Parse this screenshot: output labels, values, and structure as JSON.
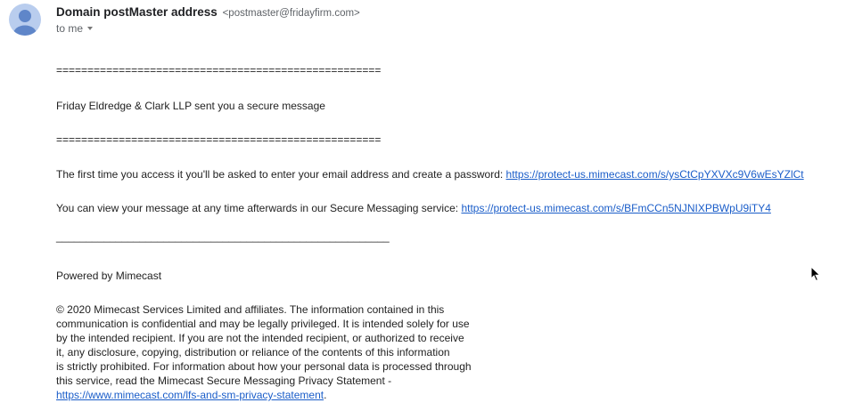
{
  "header": {
    "sender_name": "Domain postMaster address",
    "sender_email": "<postmaster@fridayfirm.com>",
    "recipient": "to me"
  },
  "body": {
    "separator": "====================================================",
    "title": "Friday  Eldredge & Clark  LLP sent you a secure message",
    "separator2": "====================================================",
    "first_access_text": "The first time you access it you'll be asked to enter your email address and create a password: ",
    "first_access_link": "https://protect-us.mimecast.com/s/ysCtCpYXVXc9V6wEsYZlCt",
    "view_text": "You can view your message at any time afterwards in our Secure Messaging service: ",
    "view_link": "https://protect-us.mimecast.com/s/BFmCCn5NJNIXPBWpU9iTY4",
    "underline": "________________________________________________________",
    "powered_by": "Powered by Mimecast",
    "legal_lines": [
      "© 2020 Mimecast Services Limited and affiliates. The information contained in this",
      "communication is confidential and may be legally privileged. It is intended solely for use",
      "by the intended recipient. If you are not the intended recipient, or authorized to receive",
      "it, any disclosure, copying, distribution or reliance of the contents of this information",
      "is strictly prohibited.  For information about how your personal data is processed through",
      "this service, read the Mimecast Secure Messaging Privacy Statement -"
    ],
    "privacy_link": "https://www.mimecast.com/lfs-and-sm-privacy-statement",
    "privacy_link_suffix": "."
  },
  "colors": {
    "link": "#1a5dc9",
    "avatar_bg": "#b9cdee",
    "avatar_fg": "#5f86c9"
  }
}
